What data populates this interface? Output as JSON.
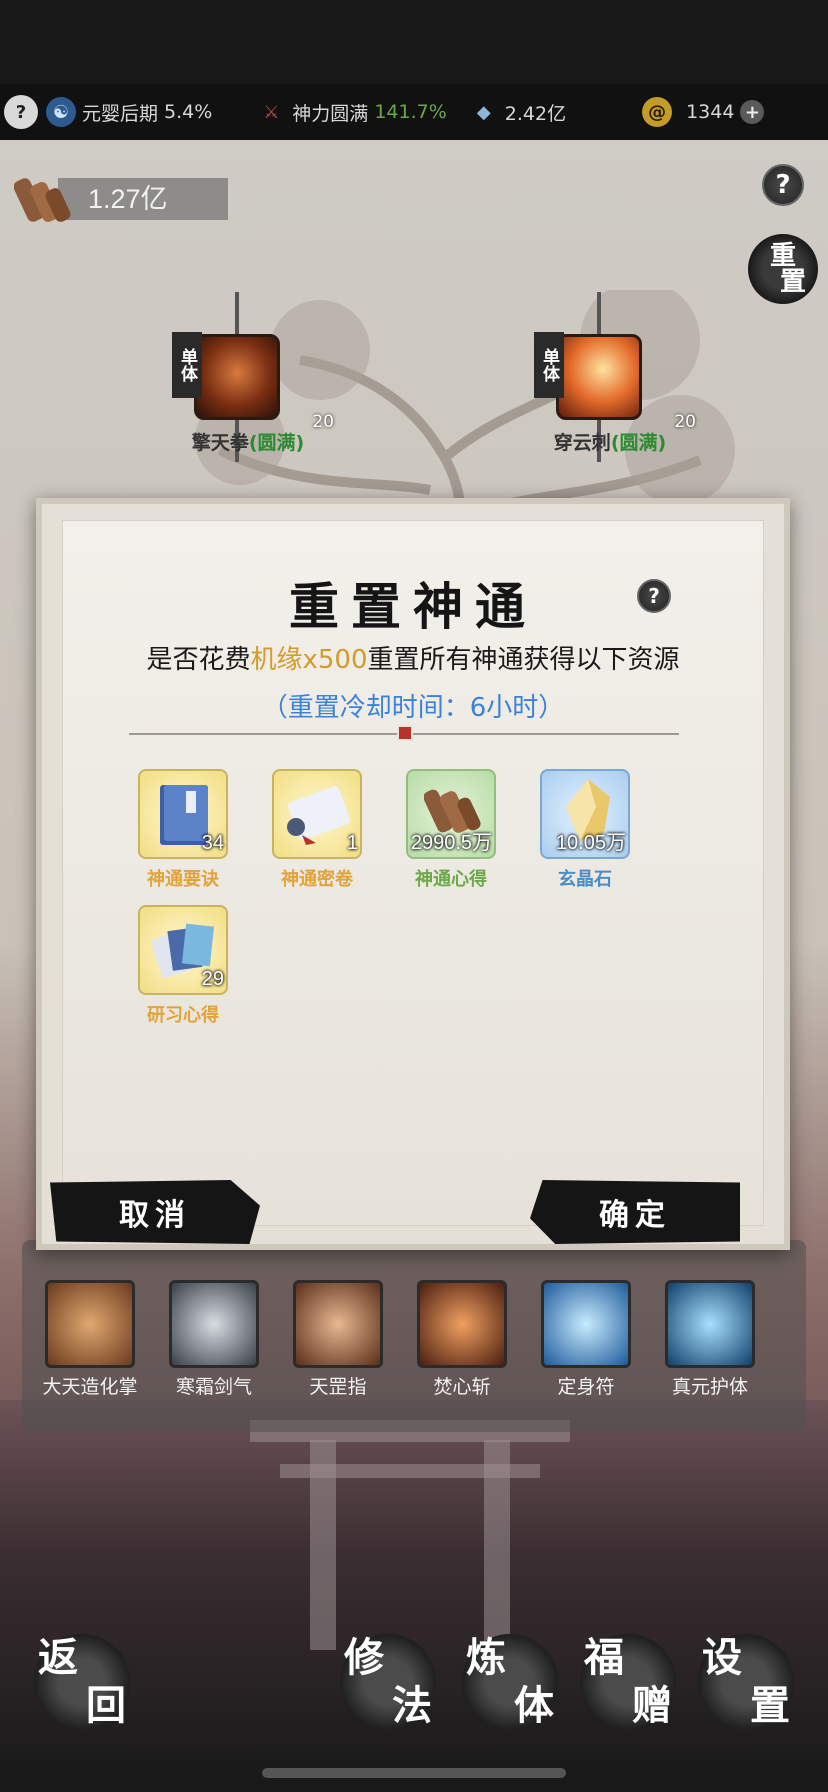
{
  "status_bar": {
    "help_icon": "question-icon",
    "realm": {
      "icon": "yin-yang-icon",
      "label": "元婴后期",
      "value": "5.4%"
    },
    "power": {
      "icon": "divine-power-icon",
      "label": "神力圆满",
      "value": "141.7%",
      "value_color": "#6aa84f"
    },
    "crystal": {
      "icon": "crystal-icon",
      "value": "2.42亿"
    },
    "currency": {
      "icon": "spiral-coin-icon",
      "value": "1344",
      "add_icon": "plus-icon"
    }
  },
  "scene": {
    "resource_scroll": {
      "icon": "scroll-icon",
      "value": "1.27亿"
    },
    "help_icon": "question-icon",
    "reset_button": {
      "chars": [
        "重",
        "置"
      ]
    },
    "skills_top": [
      {
        "tag": "单体",
        "name": "擎天拳",
        "status": "(圆满)",
        "level": "20"
      },
      {
        "tag": "单体",
        "name": "穿云刺",
        "status": "(圆满)",
        "level": "20"
      }
    ],
    "skills_bottom": [
      {
        "name": "大天造化掌"
      },
      {
        "name": "寒霜剑气"
      },
      {
        "name": "天罡指"
      },
      {
        "name": "焚心斩"
      },
      {
        "name": "定身符"
      },
      {
        "name": "真元护体"
      }
    ]
  },
  "dialog": {
    "title": "重置神通",
    "message_prefix": "是否花费",
    "message_highlight": "机缘x500",
    "message_suffix": "重置所有神通获得以下资源",
    "cooldown": "（重置冷却时间：6小时）",
    "resources": [
      {
        "name": "神通要诀",
        "count": "34",
        "icon": "blue-book-icon",
        "tier": "gold"
      },
      {
        "name": "神通密卷",
        "count": "1",
        "icon": "scroll-icon",
        "tier": "gold"
      },
      {
        "name": "神通心得",
        "count": "2990.5万",
        "icon": "bamboo-scroll-icon",
        "tier": "green"
      },
      {
        "name": "玄晶石",
        "count": "10.05万",
        "icon": "crystal-icon",
        "tier": "blue"
      },
      {
        "name": "研习心得",
        "count": "29",
        "icon": "cards-icon",
        "tier": "gold"
      }
    ],
    "cancel_label": "取消",
    "confirm_label": "确定"
  },
  "nav": [
    {
      "id": "back",
      "chars": [
        "返",
        "回"
      ]
    },
    {
      "id": "cultivate",
      "chars": [
        "修",
        "法"
      ]
    },
    {
      "id": "refine",
      "chars": [
        "炼",
        "体"
      ]
    },
    {
      "id": "gift",
      "chars": [
        "福",
        "赠"
      ]
    },
    {
      "id": "settings",
      "chars": [
        "设",
        "置"
      ]
    }
  ],
  "colors": {
    "highlight": "#d59a2a",
    "cooldown": "#3c82d8",
    "complete": "#2c8b30"
  }
}
